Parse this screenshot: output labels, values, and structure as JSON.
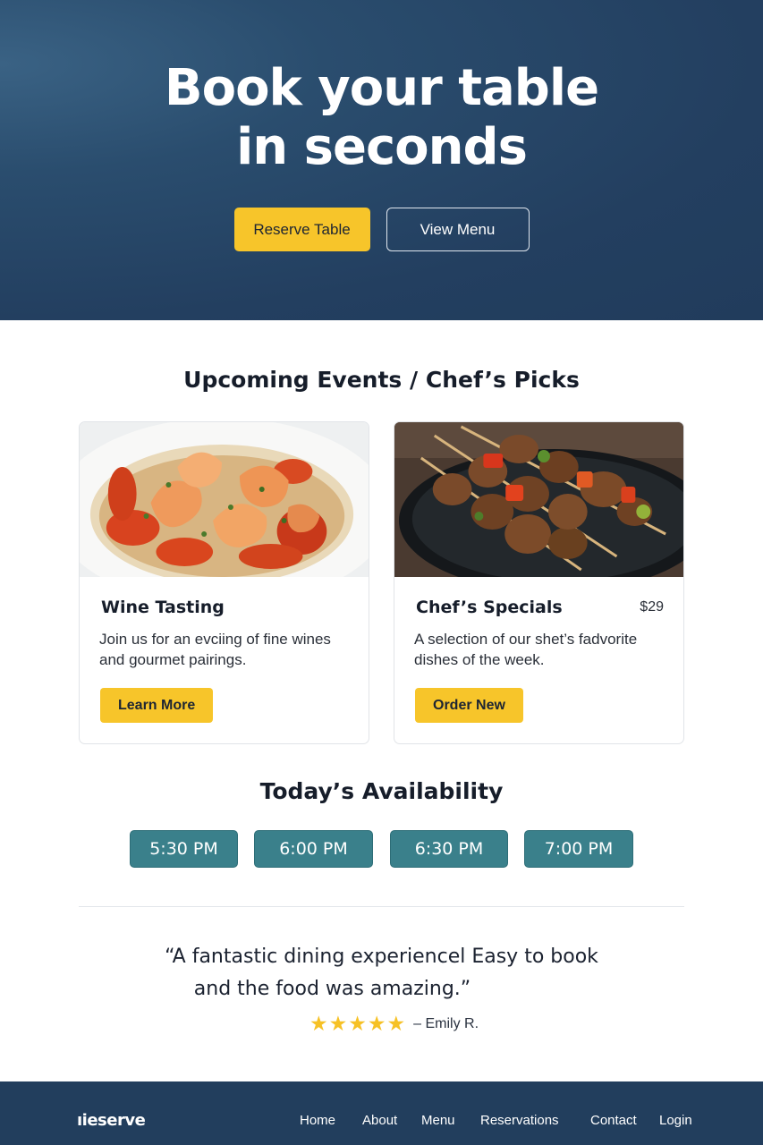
{
  "hero": {
    "title_line1": "Book your table",
    "title_line2": "in seconds",
    "primary_button": "Reserve Table",
    "secondary_button": "View Menu"
  },
  "events": {
    "heading": "Upcoming Events / Chef’s Picks",
    "cards": [
      {
        "title": "Wine Tasting",
        "price": "",
        "description": "Join us for an evciing of fine wines and gourmet pairings.",
        "button": "Learn More",
        "image": "shrimp-tomato-dish"
      },
      {
        "title": "Chef’s Specials",
        "price": "$29",
        "description": "A selection of our shet’s fadvorite dishes of the week.",
        "button": "Order New",
        "image": "meat-skewers-plate"
      }
    ]
  },
  "availability": {
    "heading": "Today’s Availability",
    "slots": [
      "5:30 PM",
      "6:00 PM",
      "6:30 PM",
      "7:00 PM"
    ]
  },
  "testimonial": {
    "quote_line1": "“A fantastic dining experiencel Easy to book",
    "quote_line2": "and the food was amazing.”",
    "stars": "★★★★★",
    "rating": 5,
    "author": "– Emily R."
  },
  "footer": {
    "logo": "ıieserve",
    "links": [
      "Home",
      "About",
      "Menu",
      "Reservations",
      "Contact",
      "Login"
    ]
  },
  "colors": {
    "hero_bg": "#233f60",
    "accent_yellow": "#f7c52a",
    "slot_teal": "#3a808b",
    "footer_bg": "#223e5d"
  }
}
